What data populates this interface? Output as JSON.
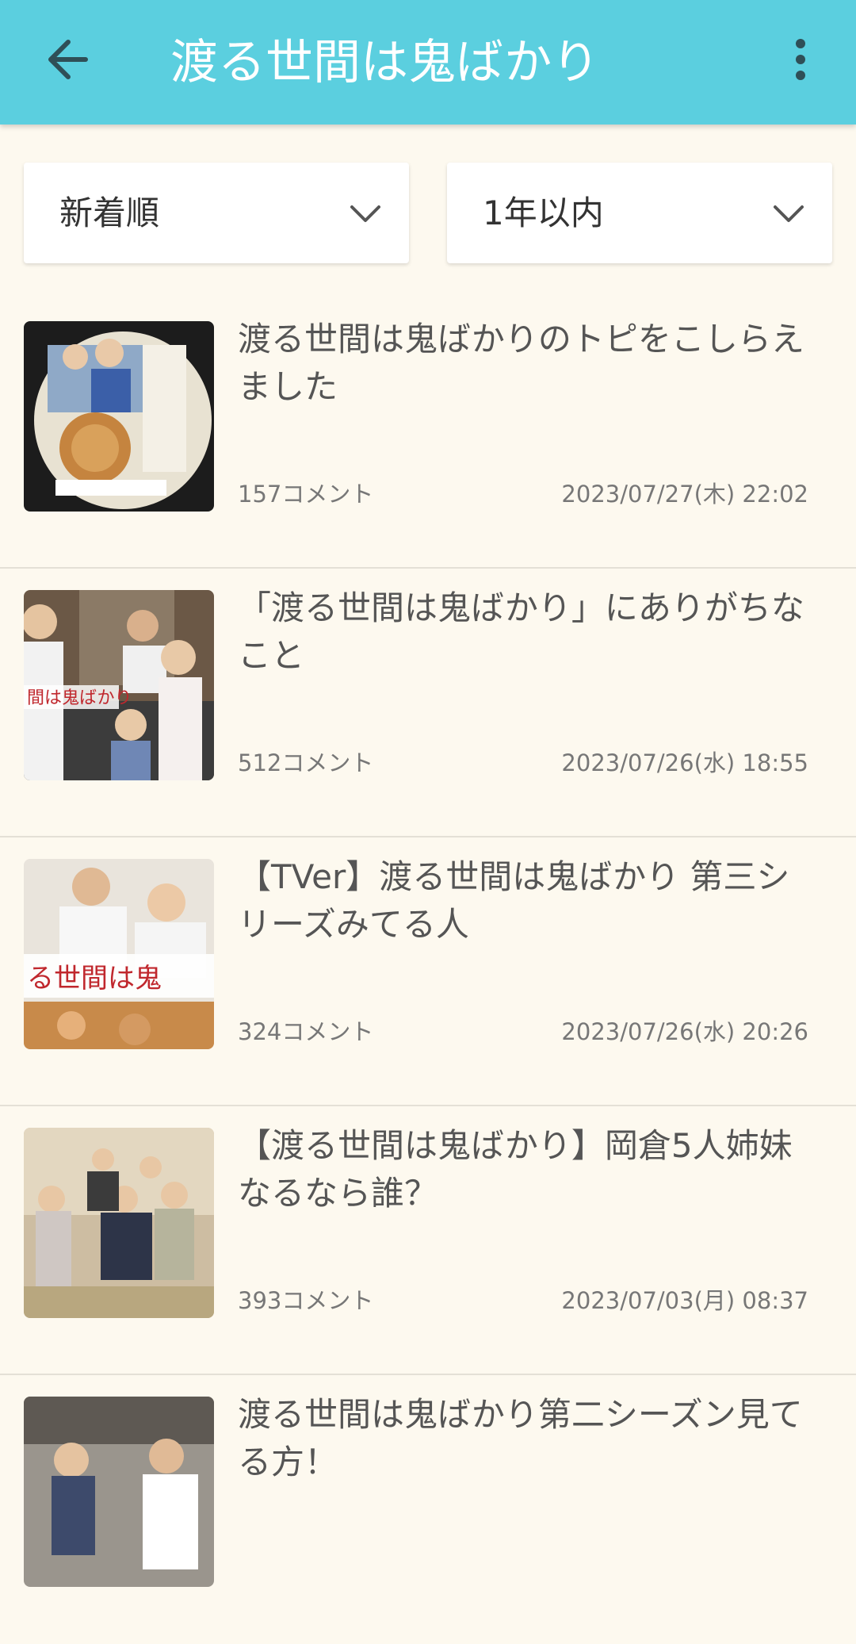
{
  "header": {
    "title": "渡る世間は鬼ばかり",
    "back_icon": "arrow-left-icon",
    "menu_icon": "more-vertical-icon",
    "accent_color": "#5bcfdf"
  },
  "filters": {
    "sort": {
      "selected": "新着順"
    },
    "period": {
      "selected": "1年以内"
    }
  },
  "topics": [
    {
      "title": "渡る世間は鬼ばかりのトピをこしらえました",
      "comments": "157コメント",
      "date": "2023/07/27(木) 22:02"
    },
    {
      "title": "「渡る世間は鬼ばかり」にありがちなこと",
      "comments": "512コメント",
      "date": "2023/07/26(水) 18:55"
    },
    {
      "title": "【TVer】渡る世間は鬼ばかり 第三シリーズみてる人",
      "comments": "324コメント",
      "date": "2023/07/26(水) 20:26"
    },
    {
      "title": "【渡る世間は鬼ばかり】岡倉5人姉妹なるなら誰？",
      "comments": "393コメント",
      "date": "2023/07/03(月) 08:37"
    },
    {
      "title": "渡る世間は鬼ばかり第二シーズン見てる方！",
      "comments": "",
      "date": ""
    }
  ]
}
